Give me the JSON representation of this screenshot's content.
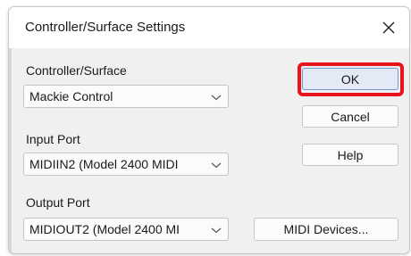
{
  "window": {
    "title": "Controller/Surface Settings"
  },
  "controller_surface": {
    "label": "Controller/Surface",
    "value": "Mackie Control"
  },
  "input_port": {
    "label": "Input Port",
    "value": "MIDIIN2 (Model 2400 MIDI"
  },
  "output_port": {
    "label": "Output Port",
    "value": "MIDIOUT2 (Model 2400 MI"
  },
  "buttons": {
    "ok": "OK",
    "cancel": "Cancel",
    "help": "Help",
    "midi_devices": "MIDI Devices..."
  },
  "icons": {
    "close": "close-icon",
    "dropdown": "chevron-down-icon"
  },
  "colors": {
    "highlight": "#e8141c",
    "ok_border": "#6f9ad6",
    "ok_fill": "#e3eaf6"
  }
}
